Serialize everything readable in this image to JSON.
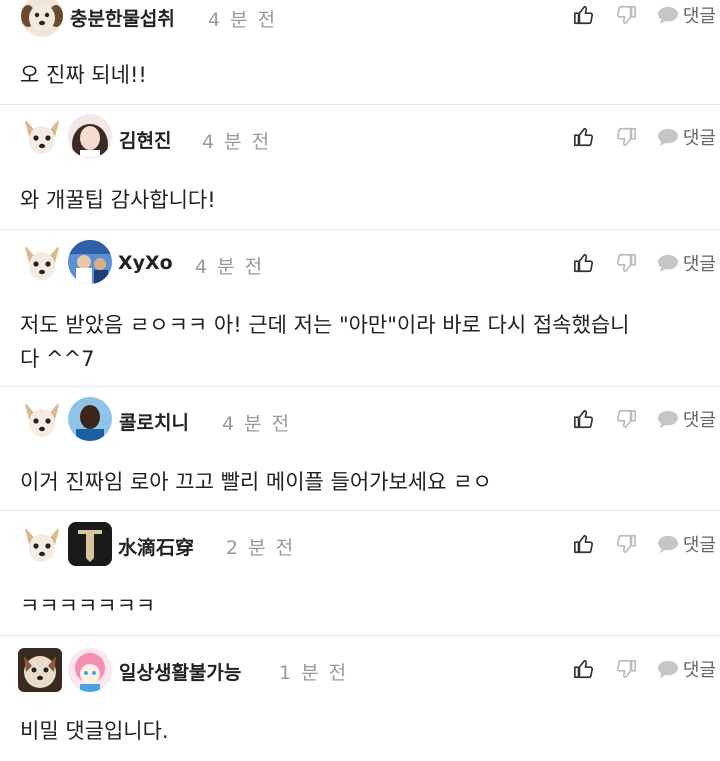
{
  "comments": [
    {
      "author": "충분한물섭취",
      "time": "4 분 전",
      "text": "오 진짜 되네!!",
      "reply_label": "댓글"
    },
    {
      "author": "김현진",
      "time": "4 분 전",
      "text": "와 개꿀팁 감사합니다!",
      "reply_label": "댓글"
    },
    {
      "author": "XyXo",
      "time": "4 분 전",
      "text": "저도 받았음 ㄹㅇㅋㅋ 아! 근데 저는 \"아만\"이라 바로 다시 접속했습니\n다 ^^7",
      "reply_label": "댓글"
    },
    {
      "author": "콜로치니",
      "time": "4 분 전",
      "text": "이거 진짜임 로아 끄고 빨리 메이플 들어가보세요 ㄹㅇ",
      "reply_label": "댓글"
    },
    {
      "author": "水滴石穿",
      "time": "2 분 전",
      "text": "ㅋㅋㅋㅋㅋㅋㅋ",
      "reply_label": "댓글"
    },
    {
      "author": "일상생활불가능",
      "time": "1 분 전",
      "text": "비밀 댓글입니다.",
      "reply_label": "댓글"
    }
  ],
  "icons": {
    "like": "thumbs-up-icon",
    "dislike": "thumbs-down-icon",
    "reply": "speech-bubble-icon"
  },
  "colors": {
    "time": "#999999",
    "divider": "#e9e9e9",
    "icon": "#555555"
  }
}
